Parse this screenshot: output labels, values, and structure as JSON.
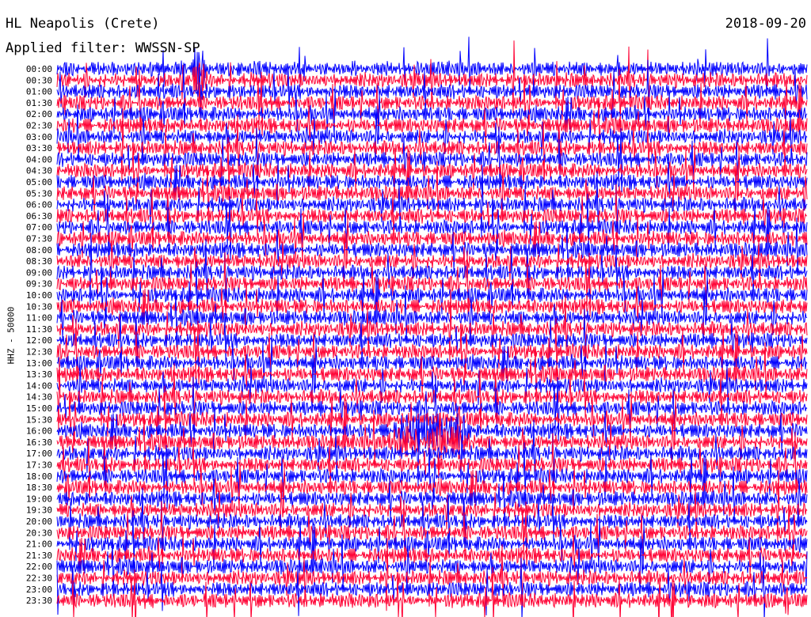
{
  "header": {
    "station": "HL Neapolis (Crete)",
    "date": "2018-09-20",
    "filter": "Applied filter: WWSSN-SP"
  },
  "chart_data": {
    "type": "line",
    "title": "HL Neapolis (Crete)",
    "ylabel": "HHZ - 50000",
    "row_labels": [
      "00:00",
      "00:30",
      "01:00",
      "01:30",
      "02:00",
      "02:30",
      "03:00",
      "03:30",
      "04:00",
      "04:30",
      "05:00",
      "05:30",
      "06:00",
      "06:30",
      "07:00",
      "07:30",
      "08:00",
      "08:30",
      "09:00",
      "09:30",
      "10:00",
      "10:30",
      "11:00",
      "11:30",
      "12:00",
      "12:30",
      "13:00",
      "13:30",
      "14:00",
      "14:30",
      "15:00",
      "15:30",
      "16:00",
      "16:30",
      "17:00",
      "17:30",
      "18:00",
      "18:30",
      "19:00",
      "19:30",
      "20:00",
      "20:30",
      "21:00",
      "21:30",
      "22:00",
      "22:30",
      "23:00",
      "23:30"
    ],
    "series": [
      {
        "name": "",
        "color": "#0000ff"
      },
      {
        "name": "",
        "color": "#ff0033"
      }
    ],
    "trace_colors": [
      "#0000ff",
      "#ff0033"
    ],
    "events": [
      {
        "row_start": 0,
        "x_start_fraction": 0.18,
        "x_end_fraction": 0.2,
        "amplitude": 1.0
      },
      {
        "row_start": 32,
        "x_start_fraction": 0.44,
        "x_end_fraction": 0.55,
        "amplitude": 0.7
      }
    ],
    "grid": false
  }
}
